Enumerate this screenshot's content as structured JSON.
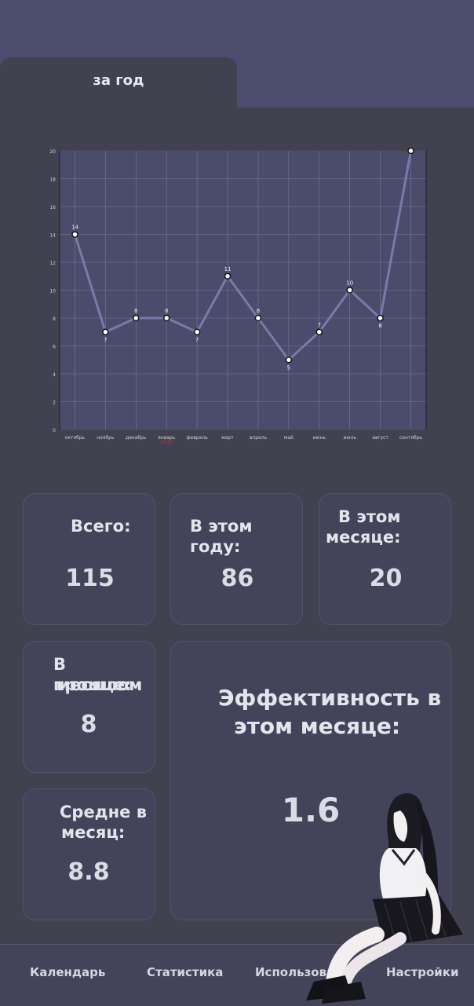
{
  "tabs": {
    "active_label": "за год"
  },
  "chart_data": {
    "type": "line",
    "categories": [
      "октябрь",
      "ноябрь",
      "декабрь",
      "январь",
      "февраль",
      "март",
      "апрель",
      "май",
      "июнь",
      "июль",
      "август",
      "сентябрь"
    ],
    "year_marker": {
      "category": "январь",
      "text": "2023"
    },
    "series": [
      {
        "values": [
          14,
          7,
          8,
          8,
          7,
          11,
          8,
          5,
          7,
          10,
          8,
          20
        ]
      }
    ],
    "ylim": [
      0,
      20
    ],
    "yticks": [
      0,
      2,
      4,
      6,
      8,
      10,
      12,
      14,
      16,
      18,
      20
    ],
    "grid": true,
    "title": "",
    "xlabel": "",
    "ylabel": ""
  },
  "stats": {
    "total": {
      "label": "Всего:",
      "value": "115"
    },
    "this_year": {
      "label": "В этом году:",
      "value": "86"
    },
    "this_month": {
      "label_line1": "В этом",
      "label_line2": "месяце:",
      "value": "20"
    },
    "last_month": {
      "label_line1": "В прошлом",
      "label_line2": "месяце:",
      "value": "8"
    },
    "average": {
      "label_line1": "Средне в",
      "label_line2": "месяц:",
      "value": "8.8"
    },
    "efficiency": {
      "label_line1": "Эффективность в",
      "label_line2": "этом месяце:",
      "value": "1.6"
    }
  },
  "nav": {
    "calendar": "Календарь",
    "statistics": "Статистика",
    "usage": "Использова",
    "settings": "Настройки"
  },
  "colors": {
    "line": "#7a7aa8",
    "plot_bg": "#4b4b6b",
    "accent_year": "#c0392b"
  }
}
